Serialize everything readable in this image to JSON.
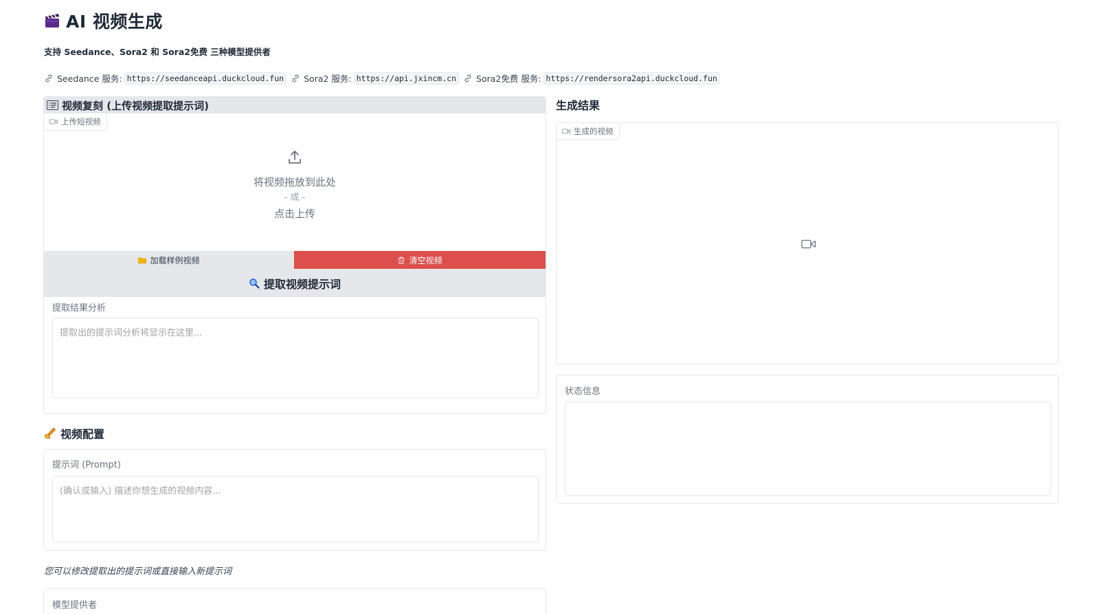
{
  "header": {
    "title": "AI 视频生成",
    "title_icon": "clapperboard-icon",
    "subtitle": "支持 Seedance、Sora2 和 Sora2免费 三种模型提供者"
  },
  "services": [
    {
      "label": "Seedance 服务:",
      "url": "https://seedanceapi.duckcloud.fun",
      "icon": "link-icon"
    },
    {
      "label": "Sora2 服务:",
      "url": "https://api.jxincm.cn",
      "icon": "link-icon"
    },
    {
      "label": "Sora2免费 服务:",
      "url": "https://rendersora2api.duckcloud.fun",
      "icon": "link-icon"
    }
  ],
  "replicate": {
    "title": "视频复刻 (上传视频提取提示词)",
    "upload_tag": "上传短视频",
    "drop_text": "将视频拖放到此处",
    "or_text": "- 或 -",
    "click_text": "点击上传",
    "load_sample_label": "加载样例视频",
    "clear_label": "清空视频",
    "extract_label": "提取视频提示词",
    "result_label": "提取结果分析",
    "result_placeholder": "提取出的提示词分析将显示在这里..."
  },
  "config": {
    "title": "视频配置",
    "prompt_label": "提示词 (Prompt)",
    "prompt_placeholder": "(确认或输入) 描述你想生成的视频内容...",
    "hint": "您可以修改提取出的提示词或直接输入新提示词",
    "provider_label": "模型提供者"
  },
  "result": {
    "title": "生成结果",
    "video_tag": "生成的视频",
    "status_label": "状态信息",
    "status_value": ""
  },
  "colors": {
    "clear_button": "#dc4f4c",
    "panel_gray": "#e5e7eb",
    "border": "#e5e7eb"
  }
}
